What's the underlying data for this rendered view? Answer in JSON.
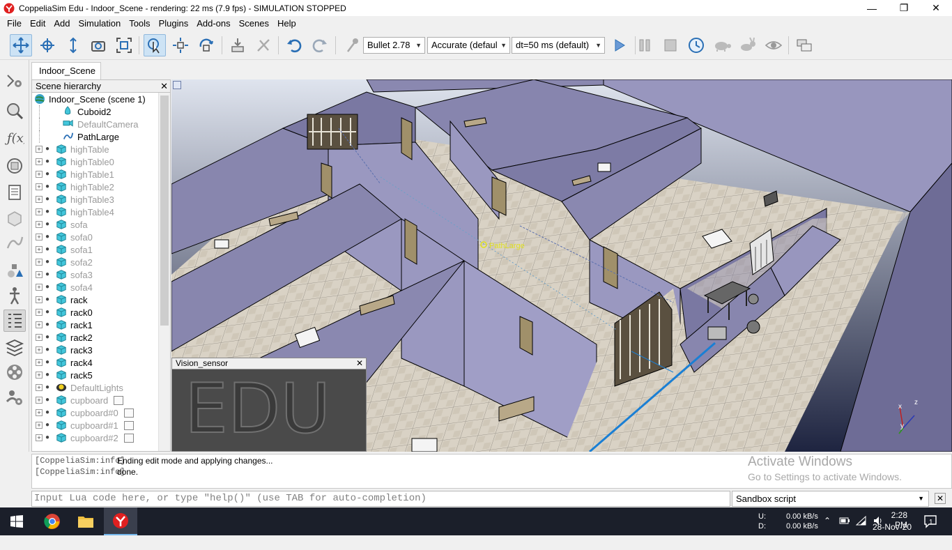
{
  "window": {
    "title": "CoppeliaSim Edu - Indoor_Scene - rendering: 22 ms (7.9 fps) - SIMULATION STOPPED",
    "minimize": "—",
    "restore": "❐",
    "close": "✕"
  },
  "menu": [
    "File",
    "Edit",
    "Add",
    "Simulation",
    "Tools",
    "Plugins",
    "Add-ons",
    "Scenes",
    "Help"
  ],
  "toolbar": {
    "engine": "Bullet 2.78",
    "accuracy": "Accurate (defaul",
    "timestep": "dt=50 ms (default)"
  },
  "scene_tab": "Indoor_Scene",
  "hierarchy": {
    "header": "Scene hierarchy",
    "close": "✕",
    "root": "Indoor_Scene (scene 1)",
    "items": [
      {
        "label": "Cuboid2",
        "icon": "shape-icon",
        "dim": false,
        "expandable": false
      },
      {
        "label": "DefaultCamera",
        "icon": "camera-icon",
        "dim": true,
        "expandable": false
      },
      {
        "label": "PathLarge",
        "icon": "path-icon",
        "dim": false,
        "expandable": false
      },
      {
        "label": "highTable",
        "icon": "cuboid-icon",
        "dim": true,
        "expandable": true
      },
      {
        "label": "highTable0",
        "icon": "cuboid-icon",
        "dim": true,
        "expandable": true
      },
      {
        "label": "highTable1",
        "icon": "cuboid-icon",
        "dim": true,
        "expandable": true
      },
      {
        "label": "highTable2",
        "icon": "cuboid-icon",
        "dim": true,
        "expandable": true
      },
      {
        "label": "highTable3",
        "icon": "cuboid-icon",
        "dim": true,
        "expandable": true
      },
      {
        "label": "highTable4",
        "icon": "cuboid-icon",
        "dim": true,
        "expandable": true
      },
      {
        "label": "sofa",
        "icon": "cuboid-icon",
        "dim": true,
        "expandable": true
      },
      {
        "label": "sofa0",
        "icon": "cuboid-icon",
        "dim": true,
        "expandable": true
      },
      {
        "label": "sofa1",
        "icon": "cuboid-icon",
        "dim": true,
        "expandable": true
      },
      {
        "label": "sofa2",
        "icon": "cuboid-icon",
        "dim": true,
        "expandable": true
      },
      {
        "label": "sofa3",
        "icon": "cuboid-icon",
        "dim": true,
        "expandable": true
      },
      {
        "label": "sofa4",
        "icon": "cuboid-icon",
        "dim": true,
        "expandable": true
      },
      {
        "label": "rack",
        "icon": "cuboid-icon",
        "dim": false,
        "expandable": true
      },
      {
        "label": "rack0",
        "icon": "cuboid-icon",
        "dim": false,
        "expandable": true
      },
      {
        "label": "rack1",
        "icon": "cuboid-icon",
        "dim": false,
        "expandable": true
      },
      {
        "label": "rack2",
        "icon": "cuboid-icon",
        "dim": false,
        "expandable": true
      },
      {
        "label": "rack3",
        "icon": "cuboid-icon",
        "dim": false,
        "expandable": true
      },
      {
        "label": "rack4",
        "icon": "cuboid-icon",
        "dim": false,
        "expandable": true
      },
      {
        "label": "rack5",
        "icon": "cuboid-icon",
        "dim": false,
        "expandable": true
      },
      {
        "label": "DefaultLights",
        "icon": "lights-icon",
        "dim": true,
        "expandable": true
      },
      {
        "label": "cupboard",
        "icon": "cuboid-icon",
        "dim": true,
        "expandable": true,
        "script": true
      },
      {
        "label": "cupboard#0",
        "icon": "cuboid-icon",
        "dim": true,
        "expandable": true,
        "script": true
      },
      {
        "label": "cupboard#1",
        "icon": "cuboid-icon",
        "dim": true,
        "expandable": true,
        "script": true
      },
      {
        "label": "cupboard#2",
        "icon": "cuboid-icon",
        "dim": true,
        "expandable": true,
        "script": true
      }
    ]
  },
  "viewport": {
    "path_label": "PathLarge",
    "axis_x": "x",
    "axis_y": "y",
    "axis_z": "z"
  },
  "vision_sensor": {
    "title": "Vision_sensor",
    "close": "✕",
    "watermark": "EDU"
  },
  "console": [
    {
      "source": "[CoppeliaSim:info]",
      "message": "Ending edit mode and applying changes..."
    },
    {
      "source": "[CoppeliaSim:info]",
      "message": "done."
    }
  ],
  "activation": {
    "line1": "Activate Windows",
    "line2": "Go to Settings to activate Windows."
  },
  "lua_input": {
    "placeholder": "Input Lua code here, or type \"help()\" (use TAB for auto-completion)"
  },
  "script_selector": "Sandbox script",
  "clear_button": "✕",
  "taskbar": {
    "net_up_label": "U:",
    "net_down_label": "D:",
    "net_up": "0.00 kB/s",
    "net_down": "0.00 kB/s",
    "time": "2:28 PM",
    "date": "28-Nov-20",
    "notifications": "1"
  },
  "colors": {
    "accent": "#1a7fd4",
    "wall": "#8a88b0",
    "floor": "#d8d2c6",
    "taskbar": "#1b1f2a"
  }
}
